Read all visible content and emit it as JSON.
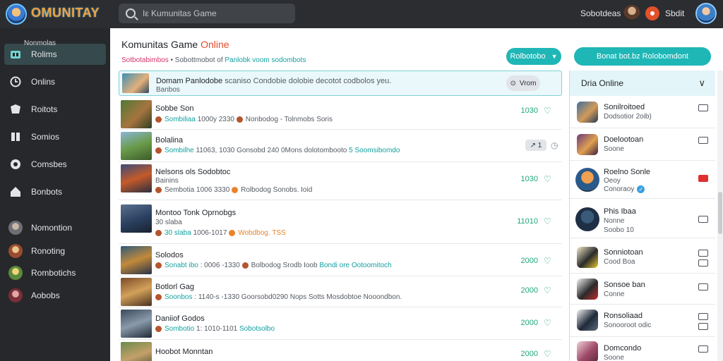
{
  "app": {
    "logo_text": "ОMUNITAY",
    "search_placeholder": "Iε Kumunitas Game",
    "links": [
      {
        "label": "Sobotdeas"
      },
      {
        "label": "Sbdit"
      }
    ]
  },
  "sidebar": {
    "items": [
      {
        "label": "Rolims",
        "sublabel": "Nonmolas"
      },
      {
        "label": "Onlins"
      },
      {
        "label": "Roitots"
      },
      {
        "label": "Somios"
      },
      {
        "label": "Comsbes"
      },
      {
        "label": "Bonbots"
      }
    ],
    "friends": [
      {
        "label": "Nomontion"
      },
      {
        "label": "Ronoting"
      },
      {
        "label": "Rombotichs"
      },
      {
        "label": "Aobobs"
      }
    ]
  },
  "main": {
    "title_prefix": "Komunitas Game ",
    "title_accent": "Online",
    "subline": {
      "pink": "Sotbotabimbos",
      "gray": " • Sobottmobot of ",
      "teal": "Panlobk voom sodombots"
    },
    "filter_button": "Rolbotobo",
    "cta_button": "Bonat bot.bz Rolobomdont"
  },
  "games": [
    {
      "title": "Domam Panlodobe",
      "meta_a": "Banbos",
      "extra": "scaniso Condobie dolobie decotot codbolos yeu.",
      "count": "",
      "view_label": "Vrom",
      "highlight": true
    },
    {
      "title": "Sobbe Son",
      "meta_a": "Sombiliaa",
      "meta_b": "1000y 2330",
      "meta_c": "Nonbodog - Tolnmobs Soris",
      "meta_c_style": "gray",
      "count": "1030",
      "icon": "heart"
    },
    {
      "title": "Bolalina",
      "meta_a": "Sombilhe",
      "meta_b": "11063, 1030",
      "meta_c": "Gonsobd 240 0Mons dolotombooto",
      "meta_d": "5 Soomsibomdo",
      "meta_c_style": "gray",
      "count": "",
      "pill": "1",
      "icon": "clock"
    },
    {
      "title": "Nelsons ols Sodobtoc",
      "meta_a": "Bainins",
      "meta_b": "",
      "meta_c": "",
      "meta_c_style": "gray",
      "count": "1030",
      "icon": "heart"
    },
    {
      "title": "",
      "meta_a": "Sembotia",
      "meta_b": "1006 3330",
      "meta_c": "Rolbodog Sonobs. Ioid",
      "meta_c_style": "gray",
      "count": "",
      "icon": ""
    },
    {
      "title": "Montoo Tonk Oprnobgs",
      "meta_a": "30 slaba",
      "meta_b": "1006-1017",
      "meta_c": "Wobdbog. TSS",
      "meta_c_style": "orange",
      "count": "11010",
      "icon": "heart"
    },
    {
      "title": "Solodos",
      "meta_a": "Sonabt ibo",
      "meta_b": ": 0006 -1330",
      "meta_c": "Bolbodog Srodb Ioob",
      "meta_c_style": "gray",
      "meta_d": "Bondi ore Ootoomitoch",
      "count": "2000",
      "icon": "heart"
    },
    {
      "title": "Botlorl Gag",
      "meta_a": "Soonbos",
      "meta_b": ": 1140-s -1330",
      "meta_c": "Goorsobd0290 Nops Sotts Mosdobtoe Nooondbon.",
      "meta_c_style": "gray",
      "count": "2000",
      "icon": "heart"
    },
    {
      "title": "Daniiof Godos",
      "meta_a": "Sombotio",
      "meta_b": "1: 1010-1101",
      "meta_c": "Sobotsolbo",
      "meta_c_style": "teal",
      "count": "2000",
      "icon": "heart"
    },
    {
      "title": "Hoobot Monntan",
      "meta_a": "",
      "meta_b": "",
      "meta_c": "",
      "meta_c_style": "gray",
      "count": "2000",
      "icon": "heart"
    }
  ],
  "friends_panel": {
    "title": "Dria Online",
    "friends": [
      {
        "name": "Sonilroitoed",
        "sub": "Dodsotior 2oib)"
      },
      {
        "name": "Doelootoan",
        "sub": "Soone"
      },
      {
        "name": "Roelno Sonle",
        "sub": "Oeoy",
        "sub2": "Conoraoy",
        "badge": "✓"
      },
      {
        "name": "Phis Ibaa",
        "sub": "Nonne",
        "sub2": "Soobo 10"
      },
      {
        "name": "Sonniotoan",
        "sub": "Cood Boa"
      },
      {
        "name": "Sonsoe ban",
        "sub": "Conne"
      },
      {
        "name": "Ronsoliaad",
        "sub": "Sonooroot odic"
      },
      {
        "name": "Domcondo",
        "sub": "Soone"
      }
    ]
  }
}
